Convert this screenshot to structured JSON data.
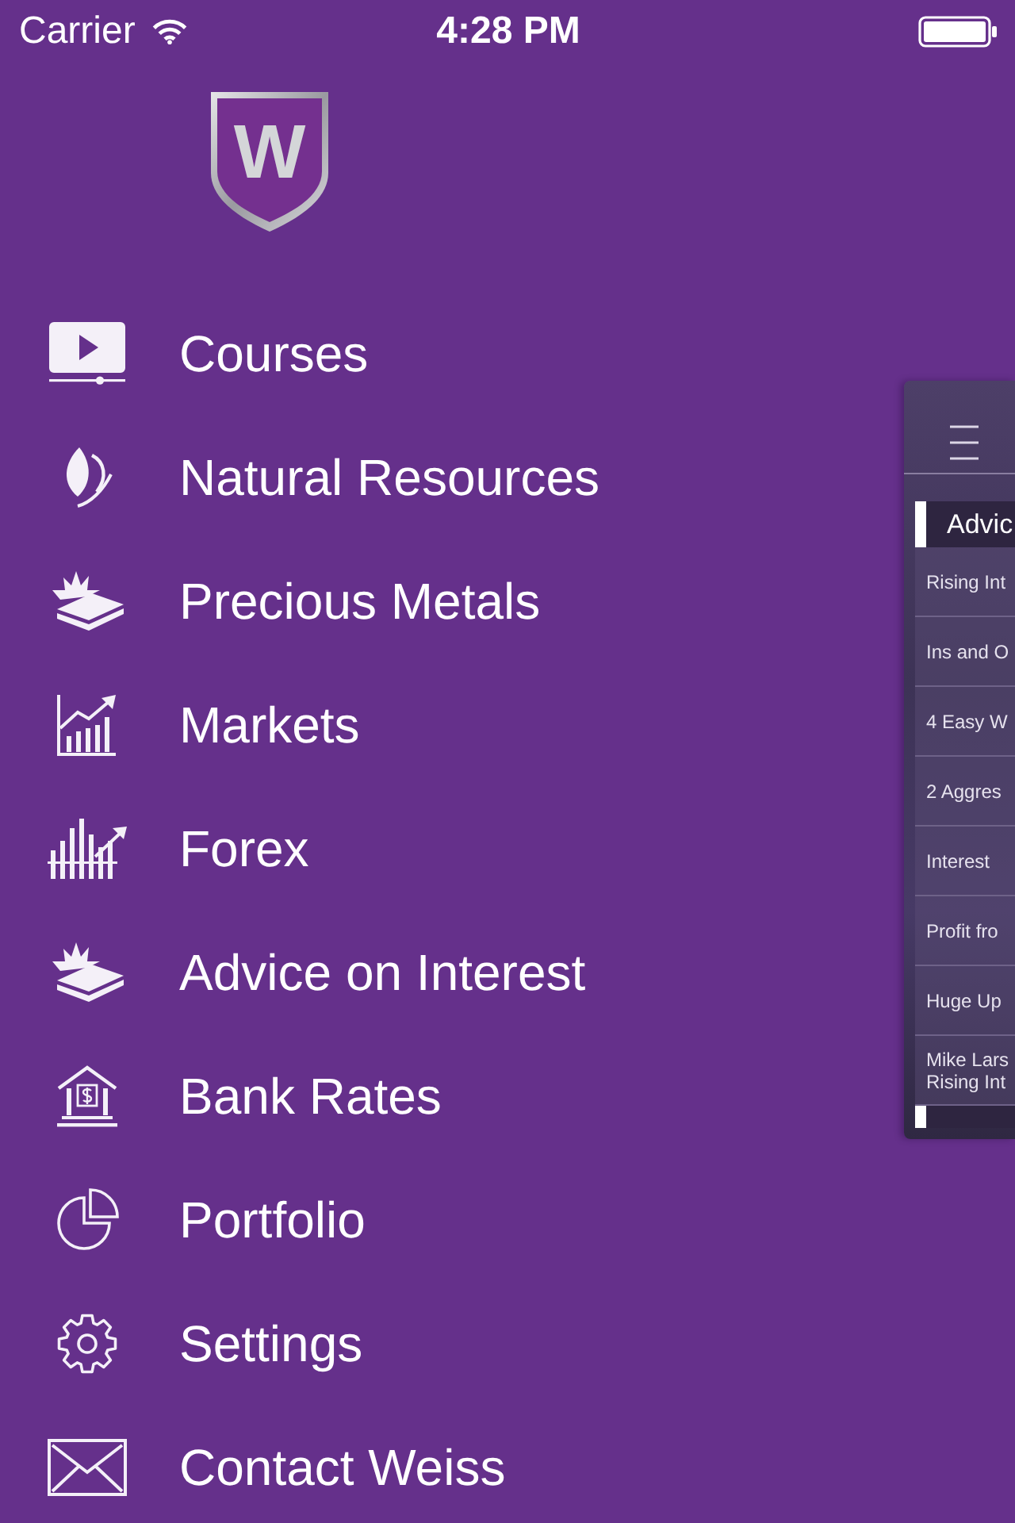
{
  "status_bar": {
    "carrier": "Carrier",
    "time": "4:28 PM"
  },
  "logo": {
    "letter": "W"
  },
  "menu": {
    "items": [
      {
        "label": "Courses",
        "kind": "video"
      },
      {
        "label": "Natural Resources",
        "kind": "leaf"
      },
      {
        "label": "Precious Metals",
        "kind": "bars"
      },
      {
        "label": "Markets",
        "kind": "chart"
      },
      {
        "label": "Forex",
        "kind": "forex"
      },
      {
        "label": "Advice on Interest",
        "kind": "bars"
      },
      {
        "label": "Bank Rates",
        "kind": "bank"
      },
      {
        "label": "Portfolio",
        "kind": "pie"
      },
      {
        "label": "Settings",
        "kind": "gear"
      },
      {
        "label": "Contact Weiss",
        "kind": "mail"
      }
    ]
  },
  "preview": {
    "section": "Advic",
    "rows": [
      "Rising Int",
      "Ins and O",
      "4 Easy W",
      "2 Aggres",
      "Interest",
      "Profit fro",
      "Huge Up",
      "Mike Lars\nRising Int"
    ]
  }
}
